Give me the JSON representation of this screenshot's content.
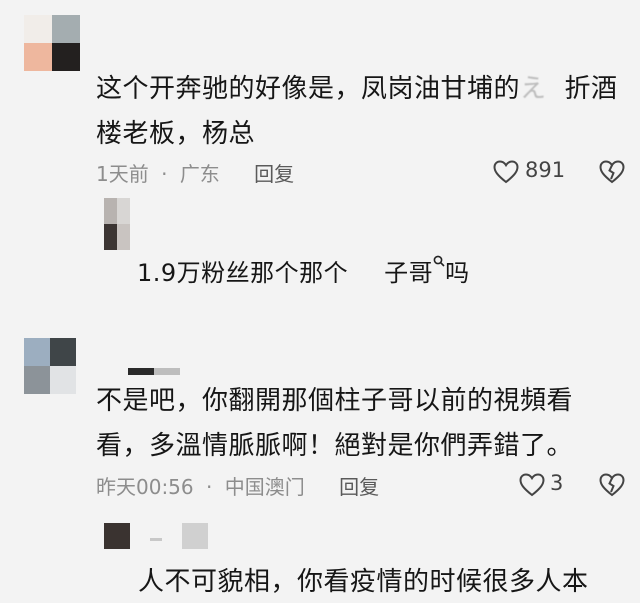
{
  "comments": [
    {
      "text_line1": "这个开奔驰的好像是，凤岗油甘埔的",
      "text_partial1": "え",
      "text_partial2": "折酒",
      "text_line2": "楼老板，杨总",
      "time": "1天前",
      "dot": "·",
      "location": "广东",
      "reply_label": "回复",
      "likes": "891",
      "reply": {
        "prefix": "1.9万粉丝那个那个",
        "partial": "子哥",
        "suffix": "吗"
      }
    },
    {
      "text_line1": "不是吧，你翻開那個柱子哥以前的視頻看",
      "text_line2": "看，多溫情脈脈啊！絕對是你們弄錯了。",
      "time": "昨天00:56",
      "dot": "·",
      "location": "中国澳门",
      "reply_label": "回复",
      "likes": "3",
      "reply": {
        "text": "人不可貌相，你看疫情的时候很多人本"
      }
    }
  ],
  "icons": {
    "like": "heart-outline-icon",
    "dislike": "broken-heart-icon",
    "search": "search-icon"
  },
  "colors": {
    "background": "#f3f3f3",
    "text": "#161616",
    "meta": "#8d8d8d"
  }
}
